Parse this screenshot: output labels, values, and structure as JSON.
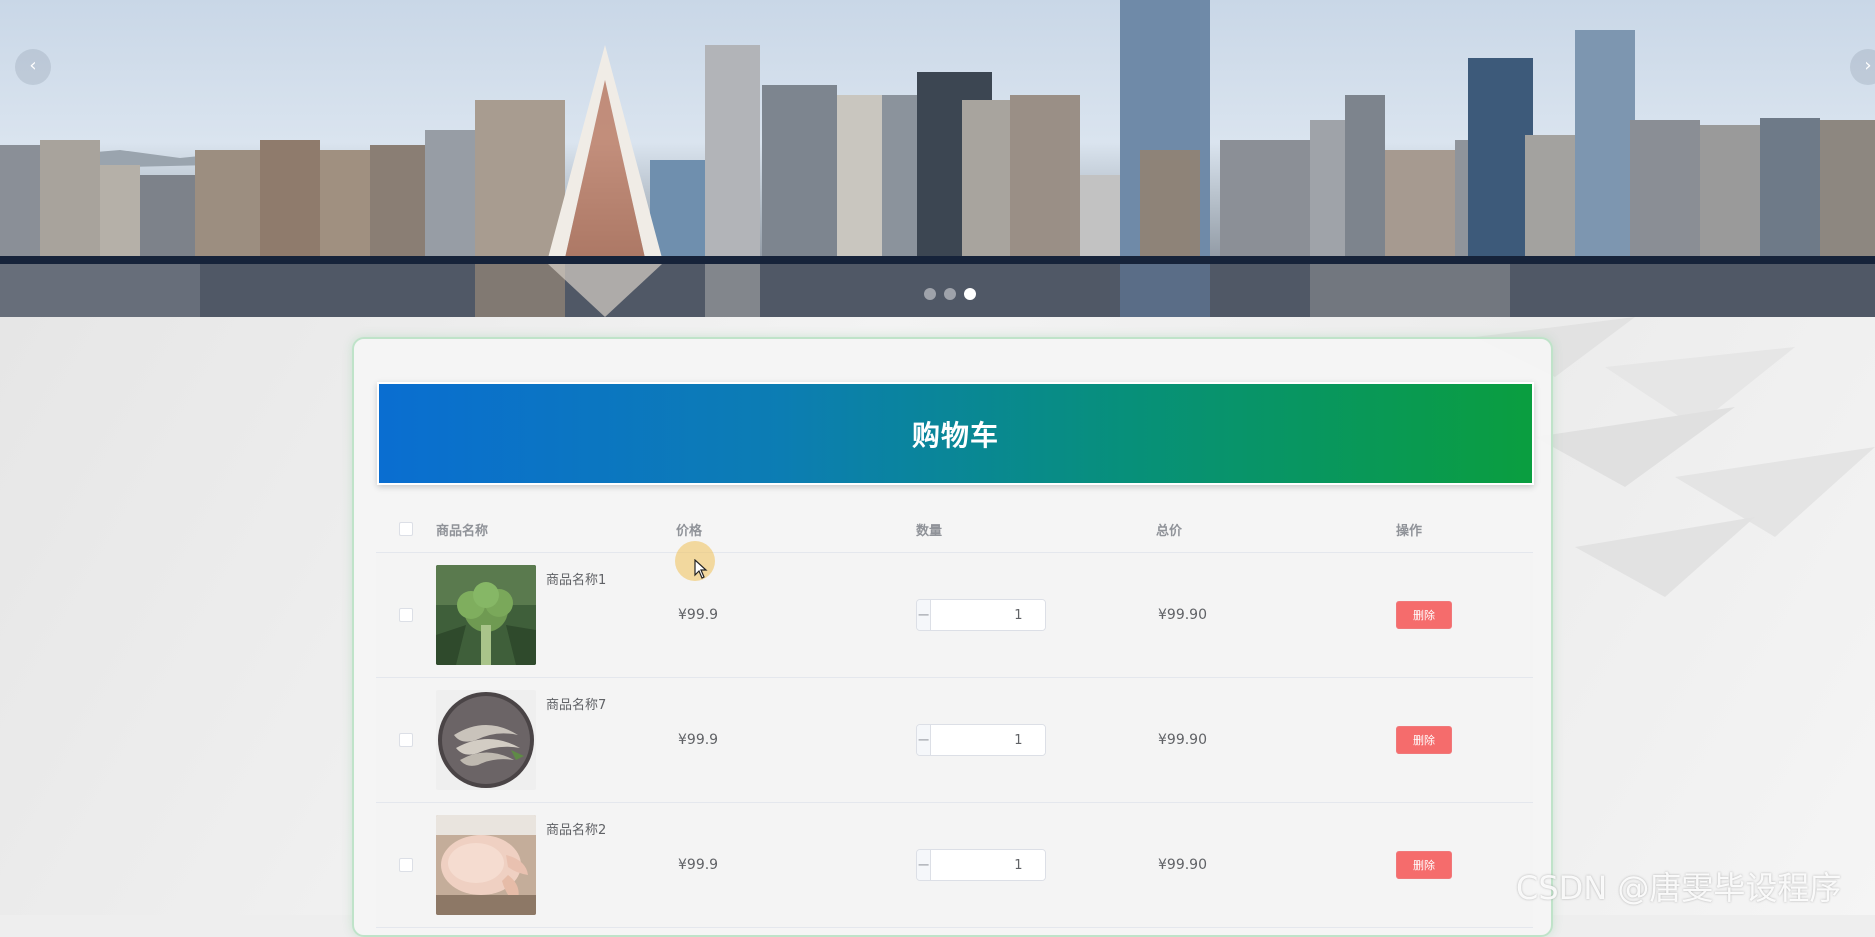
{
  "carousel": {
    "prev_icon": "chevron-left-icon",
    "next_icon": "chevron-right-icon",
    "prev_glyph": "‹",
    "next_glyph": "›",
    "slide_count": 3,
    "active_index": 2
  },
  "cart": {
    "title": "购物车",
    "columns": {
      "name": "商品名称",
      "price": "价格",
      "quantity": "数量",
      "total": "总价",
      "operation": "操作"
    },
    "stepper": {
      "minus": "−",
      "plus": "+"
    },
    "items": [
      {
        "name": "商品名称1",
        "image": "broccoli",
        "price": "¥99.9",
        "quantity": "1",
        "total": "¥99.90",
        "delete_label": "删除"
      },
      {
        "name": "商品名称7",
        "image": "shrimp",
        "price": "¥99.9",
        "quantity": "1",
        "total": "¥99.90",
        "delete_label": "删除"
      },
      {
        "name": "商品名称2",
        "image": "chicken",
        "price": "¥99.9",
        "quantity": "1",
        "total": "¥99.90",
        "delete_label": "删除"
      }
    ]
  },
  "colors": {
    "title_gradient_start": "#0a6ed1",
    "title_gradient_end": "#0a9e3f",
    "delete_button": "#f56c6c",
    "panel_border": "#bfe3c9"
  },
  "watermark": "CSDN @唐雯毕设程序"
}
